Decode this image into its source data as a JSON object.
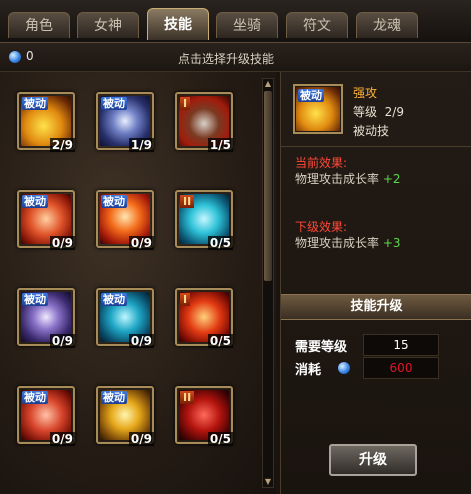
{
  "tabs": [
    "角色",
    "女神",
    "技能",
    "坐骑",
    "符文",
    "龙魂"
  ],
  "active_tab": "技能",
  "header": {
    "balance": "0",
    "hint": "点击选择升级技能"
  },
  "skills": [
    {
      "tag": "被动",
      "tag_type": "passive",
      "level": "2/9",
      "icon": "crescent-slash-icon"
    },
    {
      "tag": "被动",
      "tag_type": "passive",
      "level": "1/9",
      "icon": "lightning-slash-icon"
    },
    {
      "tag": "I",
      "tag_type": "rank",
      "level": "1/5",
      "icon": "warrior-helmet-icon"
    },
    {
      "tag": "被动",
      "tag_type": "passive",
      "level": "0/9",
      "icon": "crossed-fists-icon"
    },
    {
      "tag": "被动",
      "tag_type": "passive",
      "level": "0/9",
      "icon": "fire-shield-icon"
    },
    {
      "tag": "II",
      "tag_type": "rank",
      "level": "0/5",
      "icon": "blue-cross-icon"
    },
    {
      "tag": "被动",
      "tag_type": "passive",
      "level": "0/9",
      "icon": "sword-storm-icon"
    },
    {
      "tag": "被动",
      "tag_type": "passive",
      "level": "0/9",
      "icon": "ice-cross-icon"
    },
    {
      "tag": "I",
      "tag_type": "rank",
      "level": "0/5",
      "icon": "claw-slash-icon"
    },
    {
      "tag": "被动",
      "tag_type": "passive",
      "level": "0/9",
      "icon": "roaring-face-icon"
    },
    {
      "tag": "被动",
      "tag_type": "passive",
      "level": "0/9",
      "icon": "golden-burst-icon"
    },
    {
      "tag": "II",
      "tag_type": "rank",
      "level": "0/5",
      "icon": "blood-claw-icon"
    }
  ],
  "detail": {
    "tag": "被动",
    "name": "强攻",
    "level_label": "等级",
    "level": "2/9",
    "type": "被动技",
    "current_title": "当前效果:",
    "current_text": "物理攻击成长率",
    "current_value": "+2",
    "next_title": "下级效果:",
    "next_text": "物理攻击成长率",
    "next_value": "+3",
    "upgrade_header": "技能升级",
    "req_label": "需要等级",
    "req_value": "15",
    "cost_label": "消耗",
    "cost_value": "600",
    "button": "升级"
  }
}
